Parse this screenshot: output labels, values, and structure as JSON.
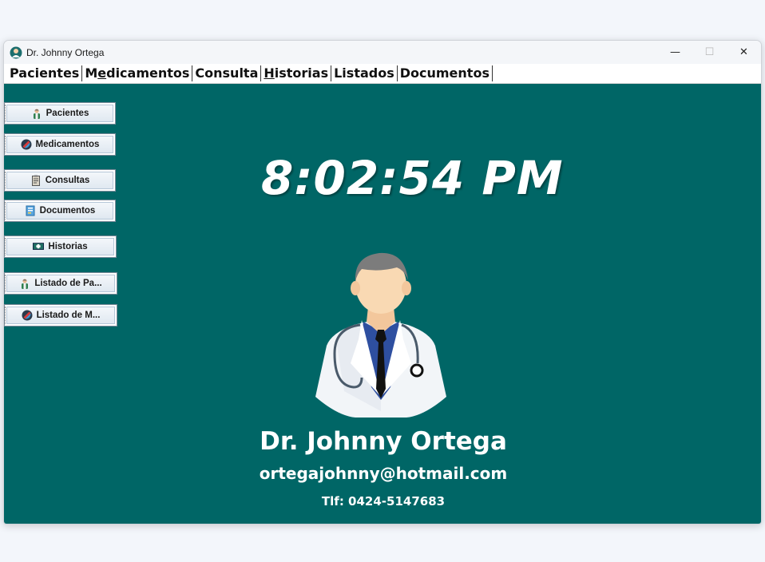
{
  "window": {
    "title": "Dr. Johnny Ortega",
    "controls": {
      "minimize": "—",
      "maximize": "☐",
      "close": "✕"
    }
  },
  "menu": [
    {
      "label": "Pacientes",
      "mnemonic": ""
    },
    {
      "label_pre": "M",
      "label_mn": "e",
      "label_post": "dicamentos"
    },
    {
      "label": "Consulta"
    },
    {
      "label_pre": "",
      "label_mn": "H",
      "label_post": "istorias"
    },
    {
      "label": "Listados"
    },
    {
      "label": "Documentos"
    }
  ],
  "sidebar": [
    {
      "label": "Pacientes",
      "icon": "patient-icon"
    },
    {
      "label": "Medicamentos",
      "icon": "pill-icon"
    },
    {
      "label": "Consultas",
      "icon": "clipboard-icon"
    },
    {
      "label": "Documentos",
      "icon": "document-icon"
    },
    {
      "label": "Historias",
      "icon": "medical-sign-icon"
    },
    {
      "label": "Listado de Pa...",
      "icon": "patient-icon"
    },
    {
      "label": "Listado de M...",
      "icon": "pill-icon"
    }
  ],
  "main": {
    "clock": "8:02:54 PM",
    "doctor_name": "Dr. Johnny Ortega",
    "email": "ortegajohnny@hotmail.com",
    "phone": "Tlf: 0424-5147683"
  },
  "colors": {
    "background": "#006666",
    "text": "#ffffff",
    "coat": "#f2f5f8",
    "shirt": "#2e4fa0",
    "hair": "#7c7c7c",
    "skin": "#f9d9b3"
  }
}
